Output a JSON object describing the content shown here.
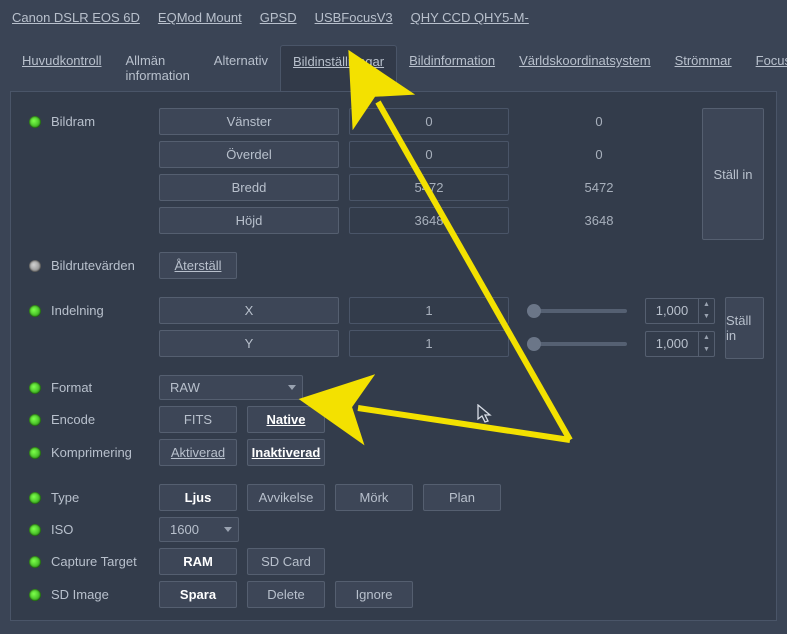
{
  "topbar": [
    "Canon DSLR EOS 6D",
    "EQMod Mount",
    "GPSD",
    "USBFocusV3",
    "QHY CCD QHY5-M-"
  ],
  "tabs": [
    "Huvudkontroll",
    "Allmän information",
    "Alternativ",
    "Bildinställningar",
    "Bildinformation",
    "Världskoordinatsystem",
    "Strömmar",
    "Focus"
  ],
  "active_tab_index": 3,
  "bildram": {
    "label": "Bildram",
    "rows": [
      {
        "name": "Vänster",
        "val": "0",
        "ro": "0"
      },
      {
        "name": "Överdel",
        "val": "0",
        "ro": "0"
      },
      {
        "name": "Bredd",
        "val": "5472",
        "ro": "5472"
      },
      {
        "name": "Höjd",
        "val": "3648",
        "ro": "3648"
      }
    ],
    "set": "Ställ in"
  },
  "bildrute": {
    "label": "Bildrutevärden",
    "reset": "Återställ"
  },
  "indelning": {
    "label": "Indelning",
    "rows": [
      {
        "name": "X",
        "val": "1",
        "spin": "1,000"
      },
      {
        "name": "Y",
        "val": "1",
        "spin": "1,000"
      }
    ],
    "set": "Ställ in"
  },
  "format": {
    "label": "Format",
    "value": "RAW"
  },
  "encode": {
    "label": "Encode",
    "opts": [
      "FITS",
      "Native"
    ],
    "selected": 1
  },
  "kompr": {
    "label": "Komprimering",
    "opts": [
      "Aktiverad",
      "Inaktiverad"
    ],
    "selected": 1
  },
  "type": {
    "label": "Type",
    "opts": [
      "Ljus",
      "Avvikelse",
      "Mörk",
      "Plan"
    ],
    "selected": 0
  },
  "iso": {
    "label": "ISO",
    "value": "1600"
  },
  "capture": {
    "label": "Capture Target",
    "opts": [
      "RAM",
      "SD Card"
    ],
    "selected": 0
  },
  "sdimage": {
    "label": "SD Image",
    "opts": [
      "Spara",
      "Delete",
      "Ignore"
    ],
    "selected": 0
  }
}
